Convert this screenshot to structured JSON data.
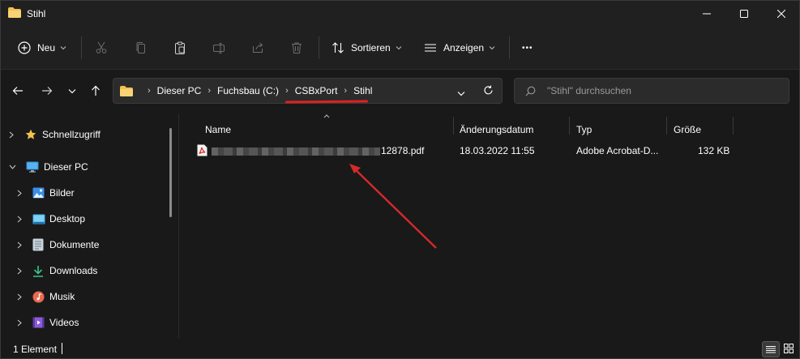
{
  "window": {
    "title": "Stihl"
  },
  "toolbar": {
    "new_label": "Neu",
    "sort_label": "Sortieren",
    "view_label": "Anzeigen",
    "more_label": "•••"
  },
  "address": {
    "breadcrumbs": [
      "Dieser PC",
      "Fuchsbau (C:)",
      "CSBxPort",
      "Stihl"
    ]
  },
  "search": {
    "placeholder": "\"Stihl\" durchsuchen"
  },
  "sidebar": {
    "items": [
      {
        "label": "Schnellzugriff",
        "icon": "star-icon"
      },
      {
        "label": "Dieser PC",
        "icon": "monitor-icon"
      },
      {
        "label": "Bilder",
        "icon": "pictures-icon"
      },
      {
        "label": "Desktop",
        "icon": "desktop-icon"
      },
      {
        "label": "Dokumente",
        "icon": "documents-icon"
      },
      {
        "label": "Downloads",
        "icon": "download-icon"
      },
      {
        "label": "Musik",
        "icon": "music-icon"
      },
      {
        "label": "Videos",
        "icon": "videos-icon"
      }
    ]
  },
  "columns": {
    "name": "Name",
    "date": "Änderungsdatum",
    "type": "Typ",
    "size": "Größe"
  },
  "files": [
    {
      "name_suffix": "12878.pdf",
      "date": "18.03.2022 11:55",
      "type": "Adobe Acrobat-D...",
      "size": "132 KB"
    }
  ],
  "status": {
    "count": "1 Element"
  },
  "colors": {
    "accent_red": "#e02020",
    "folder_yellow": "#f2c14e",
    "background": "#191919"
  }
}
